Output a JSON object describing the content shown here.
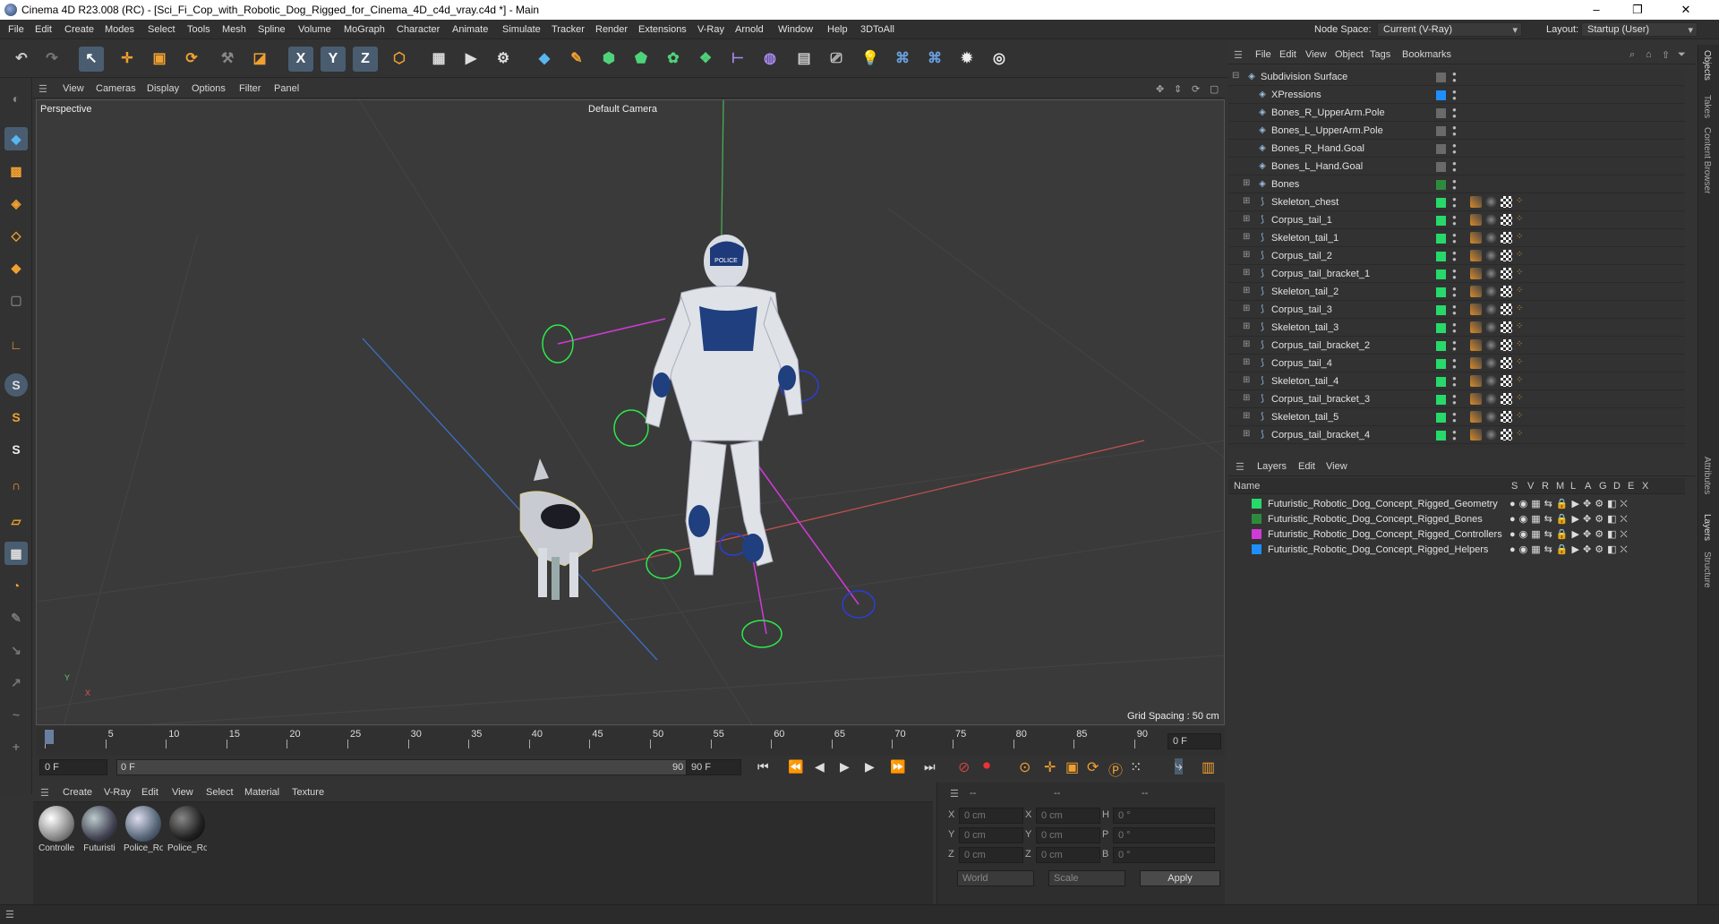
{
  "window": {
    "title": "Cinema 4D R23.008 (RC) - [Sci_Fi_Cop_with_Robotic_Dog_Rigged_for_Cinema_4D_c4d_vray.c4d *] - Main",
    "minimize": "–",
    "maximize": "❐",
    "close": "✕"
  },
  "menubar": {
    "items": [
      "File",
      "Edit",
      "Create",
      "Modes",
      "Select",
      "Tools",
      "Mesh",
      "Spline",
      "Volume",
      "MoGraph",
      "Character",
      "Animate",
      "Simulate",
      "Tracker",
      "Render",
      "Extensions",
      "V-Ray",
      "Arnold",
      "Window",
      "Help",
      "3DToAll"
    ],
    "node_space_label": "Node Space:",
    "node_space_value": "Current (V-Ray)",
    "layout_label": "Layout:",
    "layout_value": "Startup (User)"
  },
  "toolbar": {
    "axis_x": "X",
    "axis_y": "Y",
    "axis_z": "Z"
  },
  "viewport": {
    "menu": [
      "View",
      "Cameras",
      "Display",
      "Options",
      "Filter",
      "Panel"
    ],
    "label": "Perspective",
    "camera": "Default Camera",
    "grid_spacing": "Grid Spacing : 50 cm",
    "axis_y": "Y",
    "axis_x": "X",
    "head_text": "POLICE"
  },
  "timeline": {
    "ticks": [
      "0",
      "5",
      "10",
      "15",
      "20",
      "25",
      "30",
      "35",
      "40",
      "45",
      "50",
      "55",
      "60",
      "65",
      "70",
      "75",
      "80",
      "85",
      "90"
    ],
    "current_frame_right": "0 F",
    "start_field": "0 F",
    "range_start": "0 F",
    "range_end": "90 F",
    "end_field": "90 F"
  },
  "materials": {
    "menu": [
      "Create",
      "V-Ray",
      "Edit",
      "View",
      "Select",
      "Material",
      "Texture"
    ],
    "items": [
      {
        "label": "Controlle"
      },
      {
        "label": "Futuristi"
      },
      {
        "label": "Police_Ro"
      },
      {
        "label": "Police_Ro"
      }
    ]
  },
  "coordinates": {
    "header": [
      "--",
      "--",
      "--"
    ],
    "rows": [
      {
        "a": "X",
        "av": "0 cm",
        "b": "X",
        "bv": "0 cm",
        "c": "H",
        "cv": "0 °"
      },
      {
        "a": "Y",
        "av": "0 cm",
        "b": "Y",
        "bv": "0 cm",
        "c": "P",
        "cv": "0 °"
      },
      {
        "a": "Z",
        "av": "0 cm",
        "b": "Z",
        "bv": "0 cm",
        "c": "B",
        "cv": "0 °"
      }
    ],
    "world": "World",
    "scale": "Scale",
    "apply": "Apply"
  },
  "objects": {
    "menu": [
      "File",
      "Edit",
      "View",
      "Object",
      "Tags",
      "Bookmarks"
    ],
    "rows": [
      {
        "name": "Subdivision Surface",
        "color": "#6a6a6a",
        "tags": false
      },
      {
        "name": "XPressions",
        "color": "#1e8fff",
        "tags": false
      },
      {
        "name": "Bones_R_UpperArm.Pole",
        "color": "#6a6a6a",
        "tags": false
      },
      {
        "name": "Bones_L_UpperArm.Pole",
        "color": "#6a6a6a",
        "tags": false
      },
      {
        "name": "Bones_R_Hand.Goal",
        "color": "#6a6a6a",
        "tags": false
      },
      {
        "name": "Bones_L_Hand.Goal",
        "color": "#6a6a6a",
        "tags": false
      },
      {
        "name": "Bones",
        "color": "#2e8b3e",
        "tags": false
      },
      {
        "name": "Skeleton_chest",
        "color": "#27d96b",
        "tags": true
      },
      {
        "name": "Corpus_tail_1",
        "color": "#27d96b",
        "tags": true
      },
      {
        "name": "Skeleton_tail_1",
        "color": "#27d96b",
        "tags": true
      },
      {
        "name": "Corpus_tail_2",
        "color": "#27d96b",
        "tags": true
      },
      {
        "name": "Corpus_tail_bracket_1",
        "color": "#27d96b",
        "tags": true
      },
      {
        "name": "Skeleton_tail_2",
        "color": "#27d96b",
        "tags": true
      },
      {
        "name": "Corpus_tail_3",
        "color": "#27d96b",
        "tags": true
      },
      {
        "name": "Skeleton_tail_3",
        "color": "#27d96b",
        "tags": true
      },
      {
        "name": "Corpus_tail_bracket_2",
        "color": "#27d96b",
        "tags": true
      },
      {
        "name": "Corpus_tail_4",
        "color": "#27d96b",
        "tags": true
      },
      {
        "name": "Skeleton_tail_4",
        "color": "#27d96b",
        "tags": true
      },
      {
        "name": "Corpus_tail_bracket_3",
        "color": "#27d96b",
        "tags": true
      },
      {
        "name": "Skeleton_tail_5",
        "color": "#27d96b",
        "tags": true
      },
      {
        "name": "Corpus_tail_bracket_4",
        "color": "#27d96b",
        "tags": true
      }
    ]
  },
  "layers": {
    "menu": [
      "Layers",
      "Edit",
      "View"
    ],
    "columns": [
      "Name",
      "S",
      "V",
      "R",
      "M",
      "L",
      "A",
      "G",
      "D",
      "E",
      "X"
    ],
    "rows": [
      {
        "name": "Futuristic_Robotic_Dog_Concept_Rigged_Geometry",
        "color": "#27d96b"
      },
      {
        "name": "Futuristic_Robotic_Dog_Concept_Rigged_Bones",
        "color": "#2e8b3e"
      },
      {
        "name": "Futuristic_Robotic_Dog_Concept_Rigged_Controllers",
        "color": "#d13ad8"
      },
      {
        "name": "Futuristic_Robotic_Dog_Concept_Rigged_Helpers",
        "color": "#1e8fff"
      }
    ]
  },
  "side_tabs": [
    "Objects",
    "Takes",
    "Content Browser",
    "Attributes",
    "Layers",
    "Structure"
  ]
}
